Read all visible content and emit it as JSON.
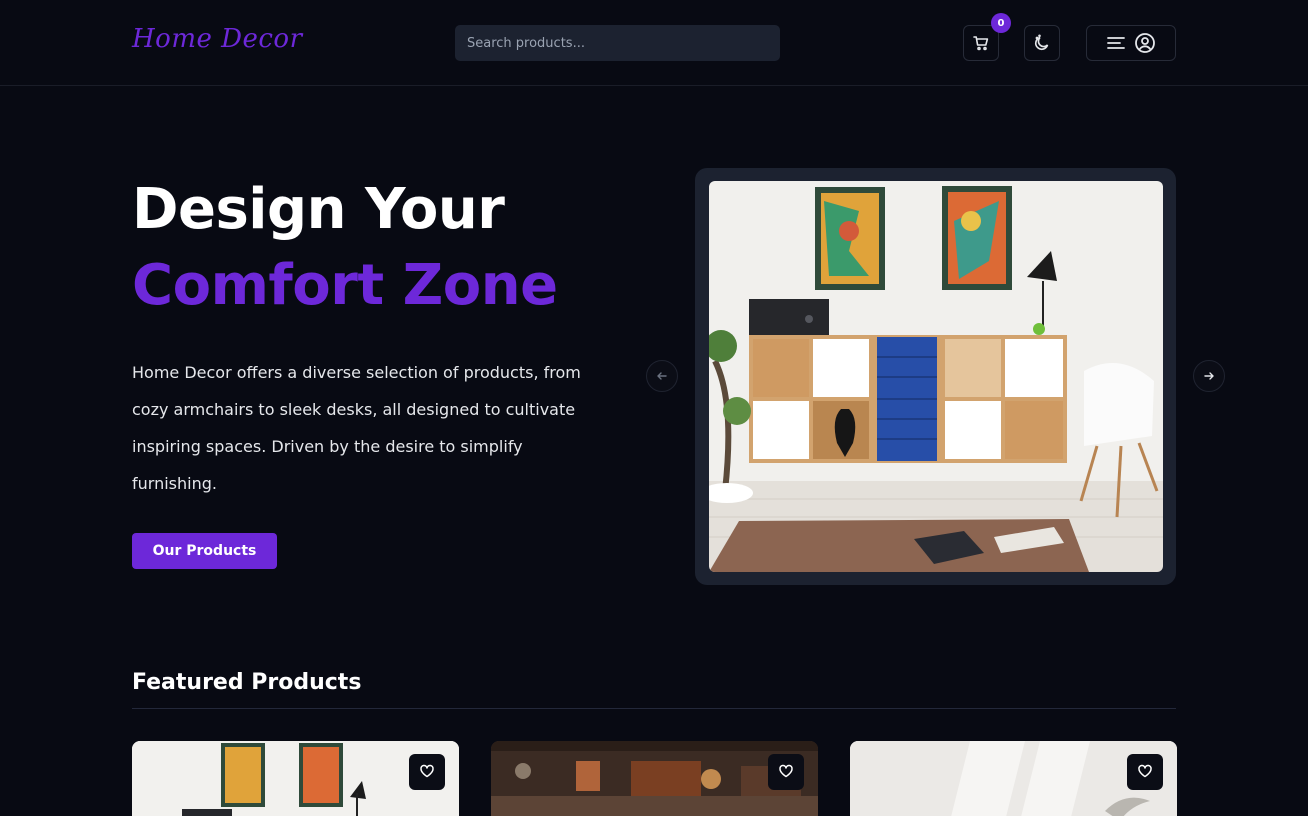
{
  "header": {
    "logo": "Home Decor",
    "search_placeholder": "Search products...",
    "cart_count": "0"
  },
  "hero": {
    "title_line1": "Design Your",
    "title_line2": "Comfort Zone",
    "description": "Home Decor offers a diverse selection of products, from cozy armchairs to sleek desks, all designed to cultivate inspiring spaces. Driven by the desire to simplify furnishing.",
    "cta_label": "Our Products"
  },
  "featured": {
    "title": "Featured Products",
    "products": [
      {
        "image": "living-room-shelf"
      },
      {
        "image": "lounge-interior"
      },
      {
        "image": "light-room-plant"
      }
    ]
  },
  "colors": {
    "background": "#080a13",
    "accent": "#6d28d9",
    "surface": "#1c2230"
  },
  "icons": {
    "cart": "cart-icon",
    "theme": "moon-icon",
    "menu": "menu-icon",
    "user": "user-icon",
    "prev": "arrow-left-icon",
    "next": "arrow-right-icon",
    "wishlist": "heart-icon"
  }
}
